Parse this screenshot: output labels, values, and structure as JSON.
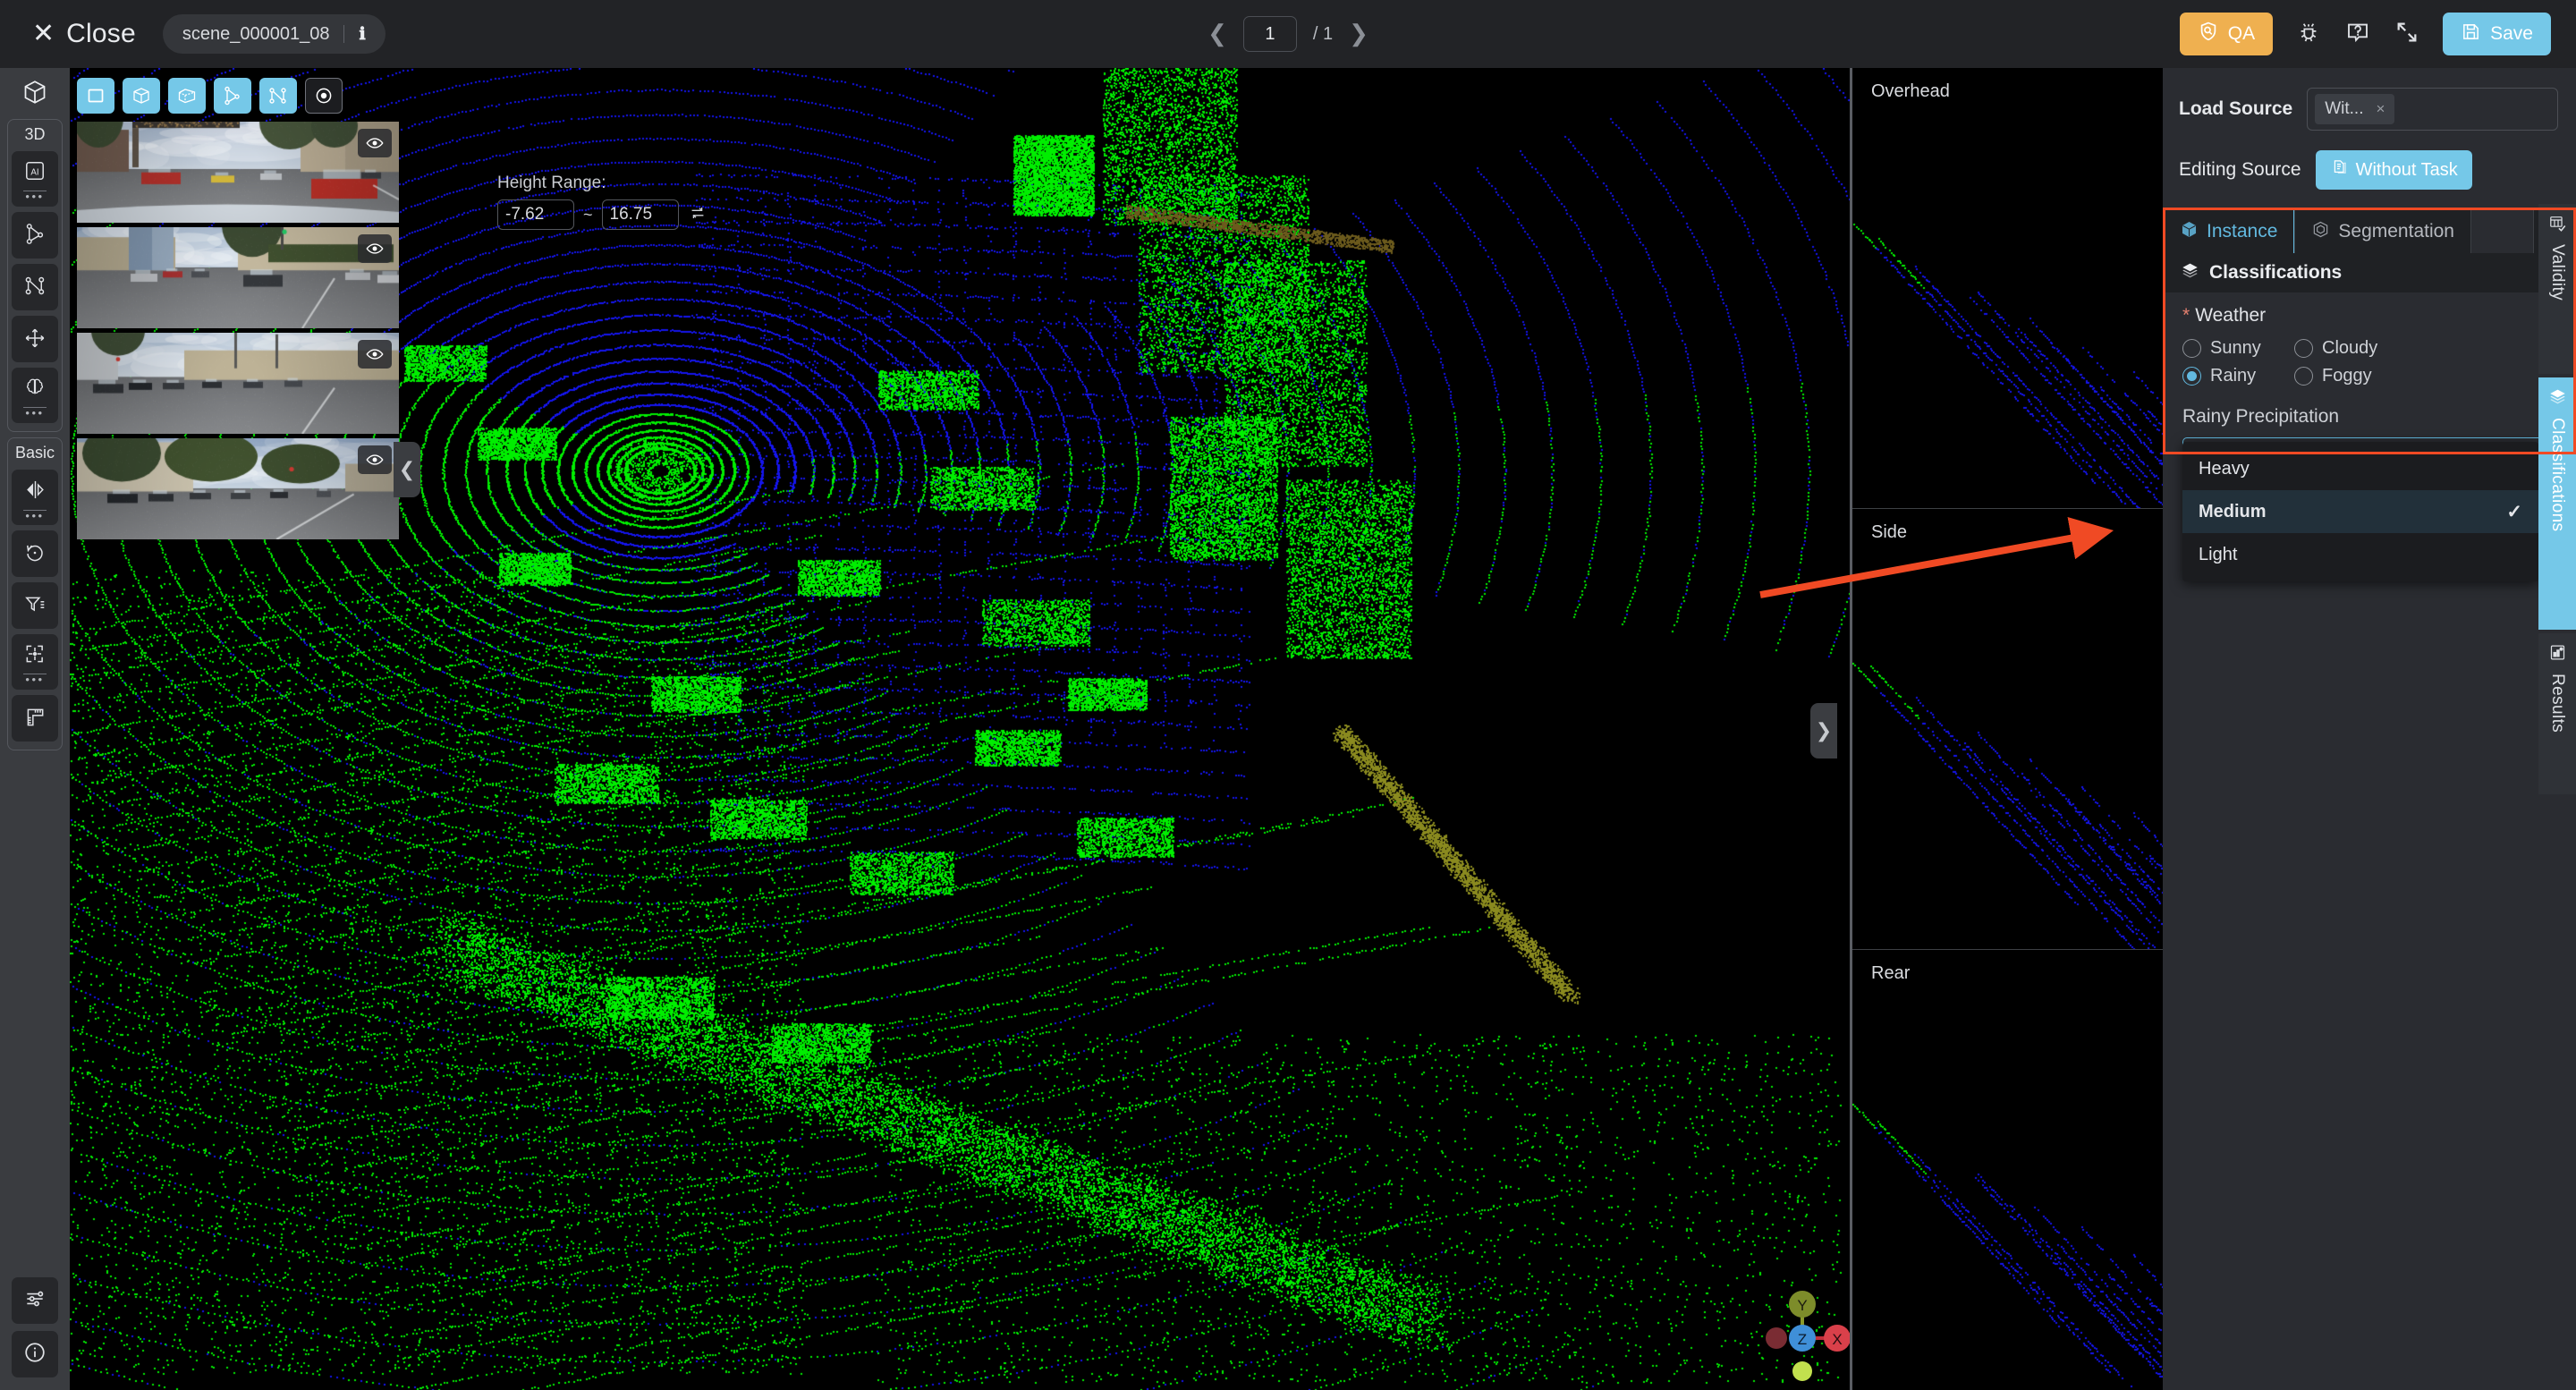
{
  "topbar": {
    "close_label": "Close",
    "close_icon": "close-x-icon",
    "scene_name": "scene_000001_08",
    "info_icon": "info-icon",
    "page_current": "1",
    "page_total": "/ 1",
    "prev_icon": "chevron-left-icon",
    "next_icon": "chevron-right-icon",
    "qa_label": "QA",
    "qa_icon": "shield-search-icon",
    "bug_icon": "bug-icon",
    "help_icon": "help-question-icon",
    "fullscreen_icon": "fullscreen-expand-icon",
    "save_label": "Save",
    "save_icon": "floppy-disk-icon",
    "qa_color": "#efb050",
    "save_color": "#75c8e8"
  },
  "left_rail": {
    "app_icon": "cube-3d-icon",
    "groups": [
      {
        "title": "3D",
        "buttons": [
          {
            "name": "ai-assist-tool",
            "icon": "ai-box-icon",
            "has_more": true
          },
          {
            "name": "polygon-tool",
            "icon": "polygon-icon",
            "has_more": false
          },
          {
            "name": "polyline-tool",
            "icon": "polyline-icon",
            "has_more": false
          },
          {
            "name": "move-tool",
            "icon": "move-arrows-icon",
            "has_more": false
          },
          {
            "name": "brain-tool",
            "icon": "brain-icon",
            "has_more": true
          }
        ]
      },
      {
        "title": "Basic",
        "buttons": [
          {
            "name": "mirror-tool",
            "icon": "mirror-flip-icon",
            "has_more": true
          },
          {
            "name": "undo-rotate-tool",
            "icon": "rotate-ccw-icon",
            "has_more": false
          },
          {
            "name": "filter-tool",
            "icon": "filter-list-icon",
            "has_more": false
          },
          {
            "name": "focus-tool",
            "icon": "crosshair-focus-icon",
            "has_more": true
          },
          {
            "name": "measure-tool",
            "icon": "ruler-icon",
            "has_more": false
          }
        ]
      }
    ],
    "bottom_buttons": [
      {
        "name": "settings-sliders",
        "icon": "sliders-icon"
      },
      {
        "name": "about-info",
        "icon": "info-circle-icon"
      }
    ]
  },
  "canvas": {
    "shape_tools": [
      {
        "name": "rectangle-tool",
        "icon": "rectangle-icon",
        "active": true
      },
      {
        "name": "cuboid-tool",
        "icon": "cube-wireframe-icon",
        "active": true
      },
      {
        "name": "box3d-tool",
        "icon": "box-dashed-icon",
        "active": true
      },
      {
        "name": "polygon-tool",
        "icon": "polygon-icon",
        "active": true
      },
      {
        "name": "polyline-tool",
        "icon": "polyline-icon",
        "active": true
      },
      {
        "name": "point-tool",
        "icon": "point-dot-icon",
        "active": false
      }
    ],
    "height_range": {
      "label": "Height Range:",
      "min": "-7.62",
      "max": "16.75",
      "separator": "~",
      "reset_icon": "reset-swap-icon"
    },
    "collapse_left_icon": "chevron-left-icon",
    "collapse_right_icon": "chevron-right-icon",
    "gizmo": {
      "axis_y": "Y",
      "axis_z": "Z",
      "axis_x": "X",
      "color_y": "#8a9a2b",
      "color_z": "#3f8fd8",
      "color_x": "#d9404a"
    },
    "thumbnails": [
      {
        "name": "camera-thumb-front",
        "eye_icon": "eye-icon"
      },
      {
        "name": "camera-thumb-front-left",
        "eye_icon": "eye-icon"
      },
      {
        "name": "camera-thumb-side",
        "eye_icon": "eye-icon"
      },
      {
        "name": "camera-thumb-rear",
        "eye_icon": "eye-icon"
      }
    ],
    "point_colors": {
      "ground": "#00ee00",
      "scan": "#1414ee",
      "dim": "#8a8a1f"
    }
  },
  "side_views": [
    {
      "label": "Overhead",
      "name": "side-view-overhead"
    },
    {
      "label": "Side",
      "name": "side-view-side"
    },
    {
      "label": "Rear",
      "name": "side-view-rear"
    }
  ],
  "right_panel": {
    "load_source_label": "Load Source",
    "load_source_tag": "Wit...",
    "load_source_tag_close": "×",
    "editing_source_label": "Editing Source",
    "editing_source_value": "Without Task",
    "editing_source_icon": "document-copy-icon",
    "tabs": [
      {
        "label": "Instance",
        "icon": "cube-3d-icon",
        "active": true,
        "name": "tab-instance"
      },
      {
        "label": "Segmentation",
        "icon": "hexagon-segment-icon",
        "active": false,
        "name": "tab-segmentation"
      }
    ],
    "filter_icon": "filter-funnel-icon",
    "classifications": {
      "header": "Classifications",
      "header_icon": "layers-icon",
      "weather": {
        "label": "Weather",
        "required_marker": "*",
        "options": [
          "Sunny",
          "Cloudy",
          "Rainy",
          "Foggy"
        ],
        "selected": "Rainy"
      },
      "precipitation": {
        "label": "Rainy Precipitation",
        "value": "Medium",
        "chevron_icon": "chevron-down-icon",
        "options": [
          "Heavy",
          "Medium",
          "Light"
        ],
        "selected": "Medium",
        "check_icon": "check-icon",
        "open": true
      }
    },
    "vertical_tabs": [
      {
        "label": "Validity",
        "icon": "validity-table-check-icon",
        "active": false,
        "name": "vtab-validity"
      },
      {
        "label": "Classifications",
        "icon": "layers-icon",
        "active": true,
        "name": "vtab-classifications"
      },
      {
        "label": "Results",
        "icon": "results-chart-icon",
        "active": false,
        "name": "vtab-results"
      }
    ],
    "highlight_color": "#f04a24",
    "accent_color": "#62b9e0"
  },
  "annotation": {
    "arrow_color": "#f04a24",
    "arrow_name": "annotation-arrow"
  }
}
